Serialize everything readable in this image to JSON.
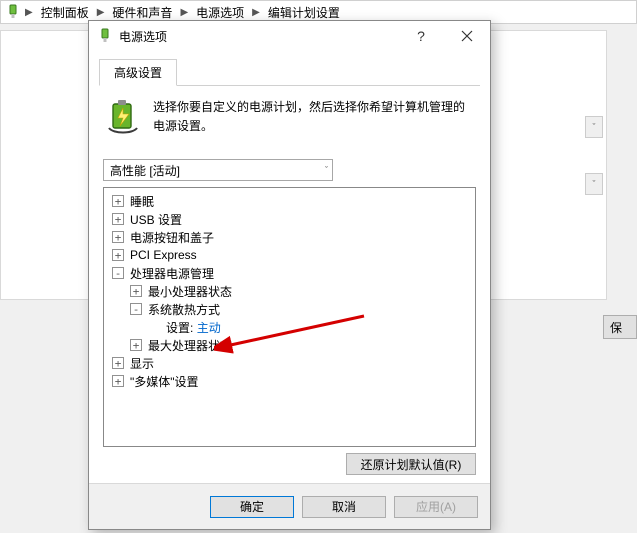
{
  "breadcrumb": {
    "items": [
      "控制面板",
      "硬件和声音",
      "电源选项",
      "编辑计划设置"
    ]
  },
  "bg": {
    "save": "保"
  },
  "dialog": {
    "title": "电源选项",
    "tab": "高级设置",
    "intro": "选择你要自定义的电源计划，然后选择你希望计算机管理的电源设置。",
    "plan": "高性能 [活动]",
    "tree": {
      "n0": "睡眠",
      "n1": "USB 设置",
      "n2": "电源按钮和盖子",
      "n3": "PCI Express",
      "n4": "处理器电源管理",
      "n4a": "最小处理器状态",
      "n4b": "系统散热方式",
      "n4b_set_lbl": "设置:",
      "n4b_set_val": "主动",
      "n4c": "最大处理器状态",
      "n5": "显示",
      "n6": "\"多媒体\"设置"
    },
    "restore": "还原计划默认值(R)",
    "ok": "确定",
    "cancel": "取消",
    "apply": "应用(A)"
  }
}
